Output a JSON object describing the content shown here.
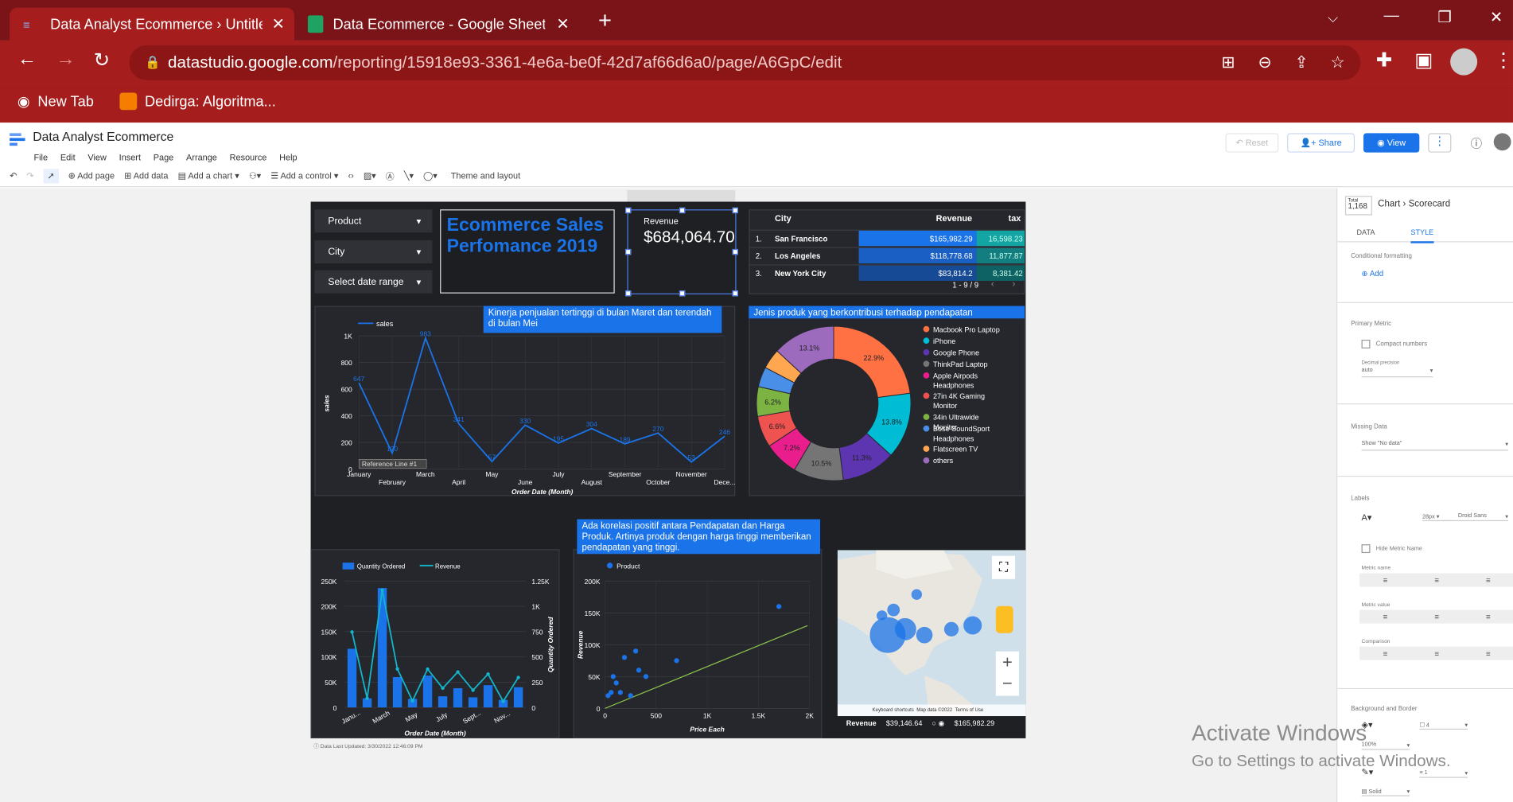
{
  "browser": {
    "tabs": [
      {
        "title": "Data Analyst Ecommerce › Untitle",
        "active": true
      },
      {
        "title": "Data Ecommerce - Google Sheets",
        "active": false
      }
    ],
    "url_host": "datastudio.google.com",
    "url_path": "/reporting/15918e93-3361-4e6a-be0f-42d7af66d6a0/page/A6GpC/edit",
    "bookmarks": [
      "New Tab",
      "Dedirga: Algoritma..."
    ]
  },
  "ds": {
    "title": "Data Analyst Ecommerce",
    "menu": [
      "File",
      "Edit",
      "View",
      "Insert",
      "Page",
      "Arrange",
      "Resource",
      "Help"
    ],
    "toolbar": {
      "add_page": "Add page",
      "add_data": "Add data",
      "add_chart": "Add a chart",
      "add_control": "Add a control",
      "theme": "Theme and layout"
    },
    "reset": "Reset",
    "share": "Share",
    "view": "View"
  },
  "report": {
    "controls": [
      "Product",
      "City",
      "Select date range"
    ],
    "title": "Ecommerce Sales Perfomance 2019",
    "scorecard": {
      "label": "Revenue",
      "value": "$684,064.70"
    },
    "city_table": {
      "headers": [
        "City",
        "Revenue",
        "tax"
      ],
      "rows": [
        [
          "1.",
          "San Francisco",
          "$165,982.29",
          "16,598.23"
        ],
        [
          "2.",
          "Los Angeles",
          "$118,778.68",
          "11,877.87"
        ],
        [
          "3.",
          "New York City",
          "$83,814.2",
          "8,381.42"
        ]
      ],
      "pager": "1 - 9 / 9"
    },
    "line_banner": "Kinerja penjualan tertinggi di bulan Maret dan terendah di bulan Mei",
    "pie_banner": "Jenis produk yang berkontribusi terhadap pendapatan",
    "scatter_banner": "Ada korelasi positif antara Pendapatan dan Harga Produk. Artinya produk dengan harga tinggi memberikan pendapatan yang tinggi.",
    "date_updated": "Data Last Updated: 3/30/2022 12:46:09 PM",
    "map": {
      "legend_label": "Revenue",
      "min": "$39,146.64",
      "max": "$165,982.29",
      "footer": [
        "Keyboard shortcuts",
        "Map data ©2022",
        "Terms of Use"
      ]
    }
  },
  "chart_data": [
    {
      "type": "line",
      "title": "",
      "xlabel": "Order Date (Month)",
      "ylabel": "sales",
      "legend": [
        "sales"
      ],
      "categories": [
        "January",
        "February",
        "March",
        "April",
        "May",
        "June",
        "July",
        "August",
        "September",
        "October",
        "November",
        "December"
      ],
      "tick_labels": [
        "January",
        "February",
        "March",
        "April",
        "May",
        "June",
        "July",
        "August",
        "September",
        "October",
        "November",
        "Dece..."
      ],
      "values": [
        647,
        120,
        983,
        341,
        57,
        330,
        195,
        304,
        189,
        270,
        53,
        246
      ],
      "ylim": [
        0,
        1000
      ],
      "yticks": [
        "0",
        "200",
        "400",
        "600",
        "800",
        "1K"
      ],
      "reference_line": "Reference Line #1"
    },
    {
      "type": "pie",
      "title": "",
      "labels": [
        "Macbook Pro Laptop",
        "iPhone",
        "Google Phone",
        "ThinkPad Laptop",
        "Apple Airpods Headphones",
        "27in 4K Gaming Monitor",
        "34in Ultrawide Monitor",
        "Bose SoundSport Headphones",
        "Flatscreen TV",
        "others"
      ],
      "values": [
        22.9,
        13.8,
        11.3,
        10.5,
        7.2,
        6.6,
        6.2,
        4.2,
        4.2,
        13.1
      ],
      "value_labels": [
        "22.9%",
        "13.8%",
        "11.3%",
        "10.5%",
        "7.2%",
        "6.6%",
        "6.2%",
        "",
        "",
        "13.1%"
      ],
      "colors": [
        "#ff7043",
        "#00bcd4",
        "#5e35b1",
        "#757575",
        "#e91e8c",
        "#ef5350",
        "#7cb342",
        "#4a8fe7",
        "#ffa651",
        "#9c6bbd"
      ]
    },
    {
      "type": "bar",
      "title": "",
      "xlabel": "Order Date (Month)",
      "ylabel_right": "Quantity Ordered",
      "series": [
        {
          "name": "Quantity Ordered",
          "type": "bar",
          "values": [
            116,
            18,
            236,
            60,
            17,
            63,
            22,
            38,
            20,
            44,
            15,
            40
          ]
        },
        {
          "name": "Revenue",
          "type": "line",
          "values": [
            746,
            90,
            1160,
            380,
            65,
            379,
            190,
            351,
            170,
            330,
            60,
            296
          ]
        }
      ],
      "categories": [
        "January",
        "February",
        "March",
        "April",
        "May",
        "June",
        "July",
        "August",
        "September",
        "October",
        "November",
        "December"
      ],
      "tick_labels": [
        "Janu...",
        "March",
        "May",
        "July",
        "Sept...",
        "Nov..."
      ],
      "ylim_left": [
        0,
        250
      ],
      "ylim_right": [
        0,
        1250
      ],
      "yticks_left": [
        "0",
        "50K",
        "100K",
        "150K",
        "200K",
        "250K"
      ],
      "yticks_right": [
        "0",
        "250",
        "500",
        "750",
        "1K",
        "1.25K"
      ]
    },
    {
      "type": "scatter",
      "title": "",
      "xlabel": "Price Each",
      "ylabel": "Revenue",
      "legend": [
        "Product"
      ],
      "x": [
        30,
        60,
        80,
        110,
        150,
        190,
        250,
        300,
        330,
        700,
        1700,
        400
      ],
      "y": [
        20,
        25,
        50,
        40,
        25,
        80,
        20,
        90,
        60,
        75,
        160,
        50
      ],
      "xlim": [
        0,
        2000
      ],
      "ylim": [
        0,
        200
      ],
      "xticks": [
        "0",
        "500",
        "1K",
        "1.5K",
        "2K"
      ],
      "yticks": [
        "0",
        "50K",
        "100K",
        "150K",
        "200K"
      ]
    }
  ],
  "right_panel": {
    "tab_chart": "Chart",
    "chart_type": "Scorecard",
    "total_label": "Total",
    "total_value": "1,168",
    "tabs": [
      "DATA",
      "STYLE"
    ],
    "sections": {
      "cond": "Conditional formatting",
      "add": "Add",
      "primary": "Primary Metric",
      "compact": "Compact numbers",
      "decimal": "Decimal precision",
      "auto": "auto",
      "missing": "Missing Data",
      "show_no_data": "Show \"No data\"",
      "labels": "Labels",
      "font_size": "28px",
      "font": "Droid Sans",
      "hide": "Hide Metric Name",
      "metric_name": "Metric name",
      "metric_value": "Metric value",
      "comparison": "Comparison",
      "bg": "Background and Border",
      "opacity": "100%",
      "border": "1",
      "solid": "Solid"
    }
  },
  "watermark": {
    "line1": "Activate Windows",
    "line2": "Go to Settings to activate Windows."
  }
}
